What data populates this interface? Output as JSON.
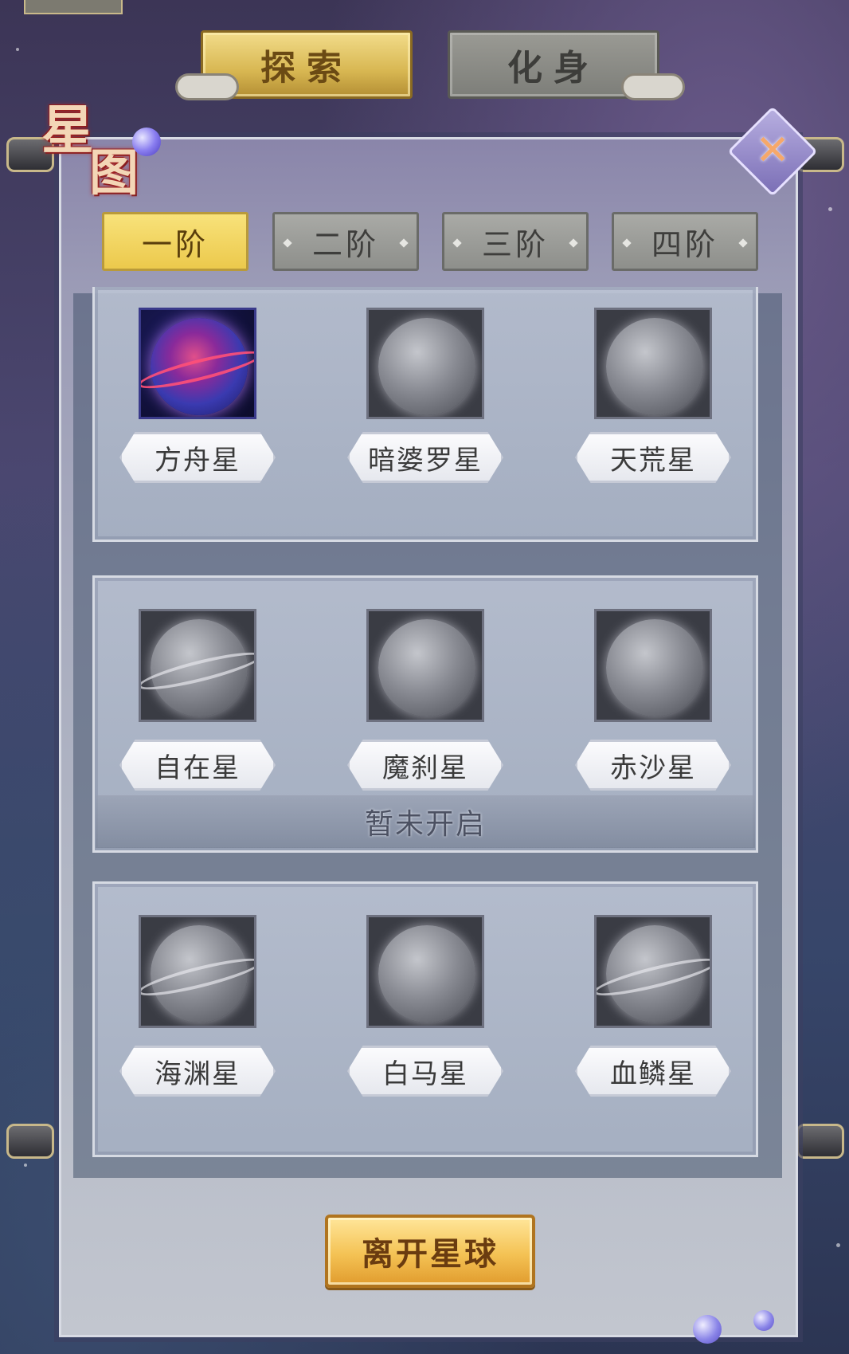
{
  "header": {
    "tabs": [
      {
        "label": "探索",
        "active": true
      },
      {
        "label": "化身",
        "active": false
      }
    ]
  },
  "panel": {
    "title": "星图",
    "close_icon": "close-icon",
    "tiers": [
      {
        "label": "一阶",
        "active": true
      },
      {
        "label": "二阶",
        "active": false
      },
      {
        "label": "三阶",
        "active": false
      },
      {
        "label": "四阶",
        "active": false
      }
    ],
    "groups": [
      {
        "planets": [
          {
            "name": "方舟星",
            "colored": true
          },
          {
            "name": "暗婆罗星",
            "colored": false
          },
          {
            "name": "天荒星",
            "colored": false
          }
        ]
      },
      {
        "planets": [
          {
            "name": "自在星",
            "colored": false
          },
          {
            "name": "魔刹星",
            "colored": false
          },
          {
            "name": "赤沙星",
            "colored": false
          }
        ],
        "status": "暂未开启"
      },
      {
        "planets": [
          {
            "name": "海渊星",
            "colored": false
          },
          {
            "name": "白马星",
            "colored": false
          },
          {
            "name": "血鳞星",
            "colored": false
          }
        ]
      }
    ],
    "leave_button": "离开星球"
  },
  "colors": {
    "gold_accent": "#e8c24c",
    "panel_bg": "#a9adbf",
    "close_x": "#f6a86a"
  }
}
